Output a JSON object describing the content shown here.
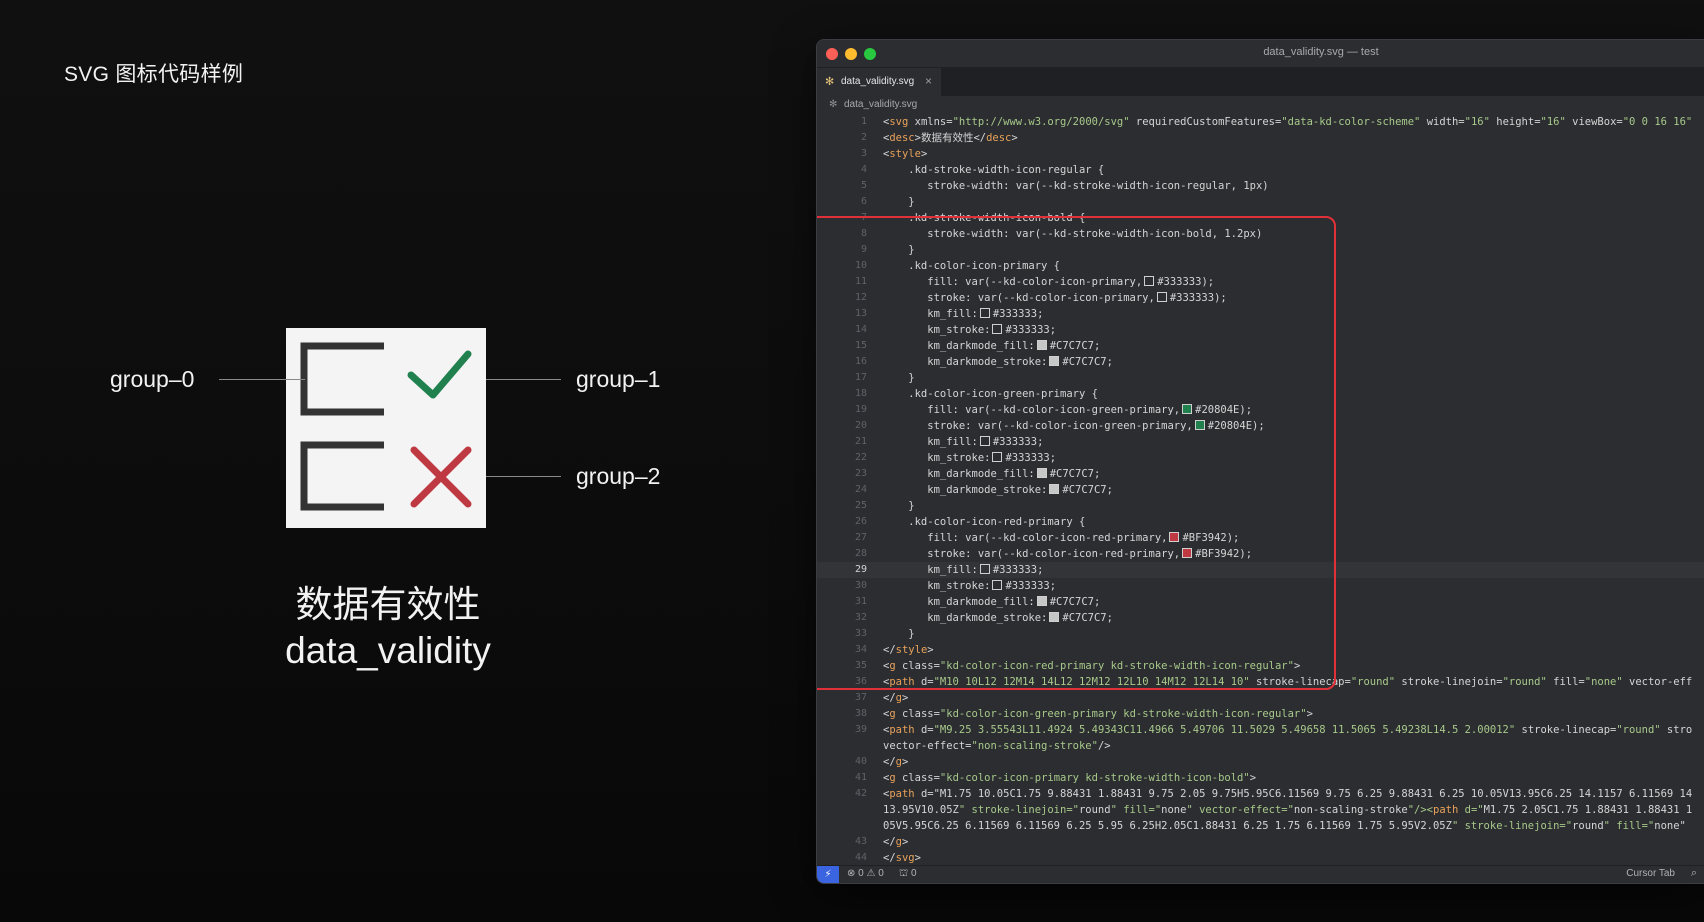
{
  "page_title": "SVG 图标代码样例",
  "icon": {
    "callouts": [
      "group–0",
      "group–1",
      "group–2"
    ],
    "name_cn": "数据有效性",
    "name_en": "data_validity",
    "colors": {
      "primary": "#333333",
      "green": "#20804E",
      "red": "#BF3942",
      "bg": "#F4F4F4"
    }
  },
  "editor": {
    "window_title": "data_validity.svg — test",
    "tab_label": "data_validity.svg",
    "tab_icon": "svg-file-icon",
    "close_glyph": "×",
    "path_label": "data_validity.svg",
    "active_line": 29,
    "lines": [
      {
        "n": "1",
        "t": "<svg xmlns=\"http://www.w3.org/2000/svg\" requiredCustomFeatures=\"data-kd-color-scheme\" width=\"16\" height=\"16\" viewBox=\"0 0 16 16\""
      },
      {
        "n": "2",
        "t": "<desc>数据有效性</desc>"
      },
      {
        "n": "3",
        "t": "<style>"
      },
      {
        "n": "4",
        "t": "    .kd-stroke-width-icon-regular {"
      },
      {
        "n": "5",
        "t": "       stroke-width: var(--kd-stroke-width-icon-regular, 1px)"
      },
      {
        "n": "6",
        "t": "    }"
      },
      {
        "n": "7",
        "t": "    .kd-stroke-width-icon-bold {"
      },
      {
        "n": "8",
        "t": "       stroke-width: var(--kd-stroke-width-icon-bold, 1.2px)"
      },
      {
        "n": "9",
        "t": "    }"
      },
      {
        "n": "10",
        "t": "    .kd-color-icon-primary {"
      },
      {
        "n": "11",
        "t": "       fill: var(--kd-color-icon-primary,□ #333333);"
      },
      {
        "n": "12",
        "t": "       stroke: var(--kd-color-icon-primary,□ #333333);"
      },
      {
        "n": "13",
        "t": "       km_fill:□ #333333;"
      },
      {
        "n": "14",
        "t": "       km_stroke:□ #333333;"
      },
      {
        "n": "15",
        "t": "       km_darkmode_fill:■ #C7C7C7;"
      },
      {
        "n": "16",
        "t": "       km_darkmode_stroke:■ #C7C7C7;"
      },
      {
        "n": "17",
        "t": "    }"
      },
      {
        "n": "18",
        "t": "    .kd-color-icon-green-primary {"
      },
      {
        "n": "19",
        "t": "       fill: var(--kd-color-icon-green-primary,■ #20804E);"
      },
      {
        "n": "20",
        "t": "       stroke: var(--kd-color-icon-green-primary,■ #20804E);"
      },
      {
        "n": "21",
        "t": "       km_fill:□ #333333;"
      },
      {
        "n": "22",
        "t": "       km_stroke:□ #333333;"
      },
      {
        "n": "23",
        "t": "       km_darkmode_fill:■ #C7C7C7;"
      },
      {
        "n": "24",
        "t": "       km_darkmode_stroke:■ #C7C7C7;"
      },
      {
        "n": "25",
        "t": "    }"
      },
      {
        "n": "26",
        "t": "    .kd-color-icon-red-primary {"
      },
      {
        "n": "27",
        "t": "       fill: var(--kd-color-icon-red-primary,■ #BF3942);"
      },
      {
        "n": "28",
        "t": "       stroke: var(--kd-color-icon-red-primary,■ #BF3942);"
      },
      {
        "n": "29",
        "t": "       km_fill:□ #333333;"
      },
      {
        "n": "30",
        "t": "       km_stroke:□ #333333;"
      },
      {
        "n": "31",
        "t": "       km_darkmode_fill:■ #C7C7C7;"
      },
      {
        "n": "32",
        "t": "       km_darkmode_stroke:■ #C7C7C7;"
      },
      {
        "n": "33",
        "t": "    }"
      },
      {
        "n": "34",
        "t": "</style>"
      },
      {
        "n": "35",
        "t": "<g class=\"kd-color-icon-red-primary kd-stroke-width-icon-regular\">"
      },
      {
        "n": "36",
        "t": "<path d=\"M10 10L12 12M14 14L12 12M12 12L10 14M12 12L14 10\" stroke-linecap=\"round\" stroke-linejoin=\"round\" fill=\"none\" vector-eff"
      },
      {
        "n": "37",
        "t": "</g>"
      },
      {
        "n": "38",
        "t": "<g class=\"kd-color-icon-green-primary kd-stroke-width-icon-regular\">"
      },
      {
        "n": "39",
        "t": "<path d=\"M9.25 3.55543L11.4924 5.49343C11.4966 5.49706 11.5029 5.49658 11.5065 5.49238L14.5 2.00012\" stroke-linecap=\"round\" stro"
      },
      {
        "n": "",
        "t": "vector-effect=\"non-scaling-stroke\"/>"
      },
      {
        "n": "40",
        "t": "</g>"
      },
      {
        "n": "41",
        "t": "<g class=\"kd-color-icon-primary kd-stroke-width-icon-bold\">"
      },
      {
        "n": "42",
        "t": "<path d=\"M1.75 10.05C1.75 9.88431 1.88431 9.75 2.05 9.75H5.95C6.11569 9.75 6.25 9.88431 6.25 10.05V13.95C6.25 14.1157 6.11569 14"
      },
      {
        "n": "",
        "t": "13.95V10.05Z\" stroke-linejoin=\"round\" fill=\"none\" vector-effect=\"non-scaling-stroke\"/><path d=\"M1.75 2.05C1.75 1.88431 1.88431 1"
      },
      {
        "n": "",
        "t": "05V5.95C6.25 6.11569 6.11569 6.25 5.95 6.25H2.05C1.88431 6.25 1.75 6.11569 1.75 5.95V2.05Z\" stroke-linejoin=\"round\" fill=\"none\" "
      },
      {
        "n": "43",
        "t": "</g>"
      },
      {
        "n": "44",
        "t": "</svg>"
      }
    ],
    "status": {
      "remote_glyph": "⚡",
      "problems": "⊗ 0 ⚠ 0",
      "ports": "⛫ 0",
      "cursor_tab": "Cursor Tab",
      "search_glyph": "⌕"
    }
  }
}
